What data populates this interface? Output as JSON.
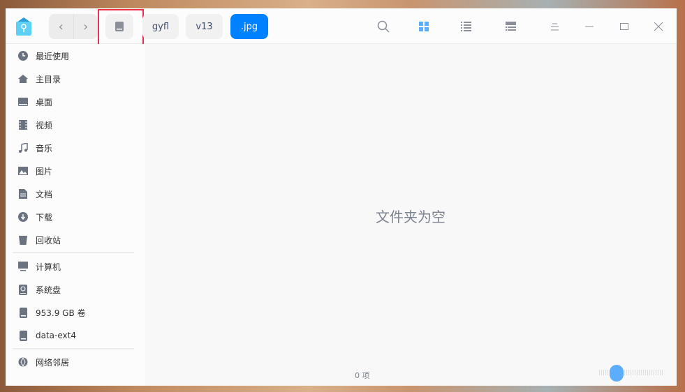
{
  "toolbar": {
    "back": "‹",
    "forward": "›",
    "breadcrumbs": [
      "gyfl",
      "v13",
      ".jpg"
    ]
  },
  "sidebar": {
    "items": [
      {
        "label": "最近使用",
        "icon": "clock-icon"
      },
      {
        "label": "主目录",
        "icon": "home-icon"
      },
      {
        "label": "桌面",
        "icon": "desktop-icon"
      },
      {
        "label": "视频",
        "icon": "video-icon"
      },
      {
        "label": "音乐",
        "icon": "music-icon"
      },
      {
        "label": "图片",
        "icon": "picture-icon"
      },
      {
        "label": "文档",
        "icon": "document-icon"
      },
      {
        "label": "下载",
        "icon": "download-icon"
      },
      {
        "label": "回收站",
        "icon": "trash-icon"
      }
    ],
    "devices": [
      {
        "label": "计算机",
        "icon": "computer-icon"
      },
      {
        "label": "系统盘",
        "icon": "system-disk-icon"
      },
      {
        "label": "953.9 GB 卷",
        "icon": "disk-icon"
      },
      {
        "label": "data-ext4",
        "icon": "disk-icon"
      }
    ],
    "network": {
      "label": "网络邻居",
      "icon": "network-icon"
    }
  },
  "main": {
    "empty_text": "文件夹为空",
    "item_count": "0 项",
    "icon_size_fraction": 0.2
  },
  "colors": {
    "accent": "#0081ff",
    "highlight": "#f0304f"
  }
}
